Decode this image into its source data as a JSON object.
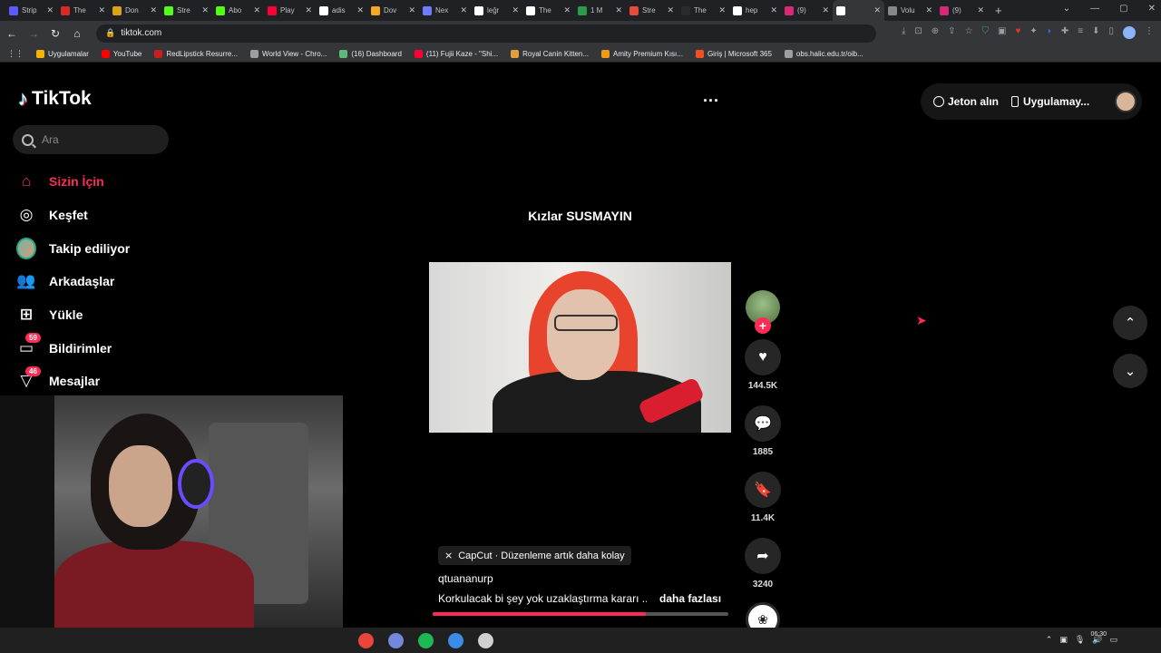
{
  "browser": {
    "tabs": [
      {
        "title": "Strip",
        "color": "#5b5bff"
      },
      {
        "title": "The",
        "color": "#d92a2a"
      },
      {
        "title": "Don",
        "color": "#d9a21b"
      },
      {
        "title": "Stre",
        "color": "#53fc18"
      },
      {
        "title": "Abo",
        "color": "#53fc18"
      },
      {
        "title": "Play",
        "color": "#ff0033"
      },
      {
        "title": "adis",
        "color": "#ffffff"
      },
      {
        "title": "Dov",
        "color": "#f5a623"
      },
      {
        "title": "Nex",
        "color": "#6e7dff"
      },
      {
        "title": "leğr",
        "color": "#ffffff"
      },
      {
        "title": "The",
        "color": "#ffffff"
      },
      {
        "title": "1 M",
        "color": "#2b9b4a"
      },
      {
        "title": "Stre",
        "color": "#e34b3b"
      },
      {
        "title": "The",
        "color": "#2b2b2b"
      },
      {
        "title": "hep",
        "color": "#ffffff"
      },
      {
        "title": "(9)",
        "color": "#d62976"
      },
      {
        "title": "",
        "color": "#ffffff"
      },
      {
        "title": "Volu",
        "color": "#888888"
      },
      {
        "title": "(9)",
        "color": "#d62976"
      }
    ],
    "active_tab_index": 16,
    "url": "tiktok.com",
    "bookmarks": [
      {
        "label": "Uygulamalar",
        "color": "#f4b400"
      },
      {
        "label": "YouTube",
        "color": "#ff0000"
      },
      {
        "label": "RedLipstick Resurre...",
        "color": "#c81e1e"
      },
      {
        "label": "World View - Chro...",
        "color": "#9e9e9e"
      },
      {
        "label": "(16) Dashboard",
        "color": "#5fb878"
      },
      {
        "label": "(11) Fujii Kaze - \"Shi...",
        "color": "#ff0033"
      },
      {
        "label": "Royal Canin Kitten...",
        "color": "#e2a03a"
      },
      {
        "label": "Amity Premium Kısı...",
        "color": "#f09a1a"
      },
      {
        "label": "Giriş | Microsoft 365",
        "color": "#f25022"
      },
      {
        "label": "obs.halic.edu.tr/oib...",
        "color": "#9e9e9e"
      }
    ]
  },
  "tiktok": {
    "logo": "TikTok",
    "search_placeholder": "Ara",
    "nav": [
      {
        "label": "Sizin İçin",
        "icon": "home-icon",
        "glyph": "⌂",
        "active": true
      },
      {
        "label": "Keşfet",
        "icon": "compass-icon",
        "glyph": "◎"
      },
      {
        "label": "Takip ediliyor",
        "icon": "following-avatar-icon",
        "glyph": ""
      },
      {
        "label": "Arkadaşlar",
        "icon": "friends-icon",
        "glyph": "👥"
      },
      {
        "label": "Yükle",
        "icon": "upload-icon",
        "glyph": "⊞"
      },
      {
        "label": "Bildirimler",
        "icon": "inbox-icon",
        "glyph": "▭",
        "badge": "59"
      },
      {
        "label": "Mesajlar",
        "icon": "message-icon",
        "glyph": "▽",
        "badge": "46"
      }
    ],
    "more_menu": "...",
    "header": {
      "coins": "Jeton alın",
      "app": "Uygulamay..."
    },
    "video": {
      "overlay_text": "Kızlar SUSMAYIN",
      "capcut_label": "CapCut · Düzenleme artık daha kolay",
      "author": "qtuananurp",
      "description": "Korkulacak bi şey yok uzaklaştırma kararı ...",
      "more": "daha fazlası",
      "progress": 0.72
    },
    "actions": {
      "likes": "144.5K",
      "comments": "1885",
      "saves": "11.4K",
      "shares": "3240"
    }
  },
  "taskbar": {
    "icons": [
      {
        "name": "chrome",
        "color": "#e8453c"
      },
      {
        "name": "discord",
        "color": "#7289da"
      },
      {
        "name": "spotify",
        "color": "#1db954"
      },
      {
        "name": "app",
        "color": "#3c8ce7"
      },
      {
        "name": "obs",
        "color": "#d0d0d0"
      }
    ],
    "time": "06:30"
  }
}
